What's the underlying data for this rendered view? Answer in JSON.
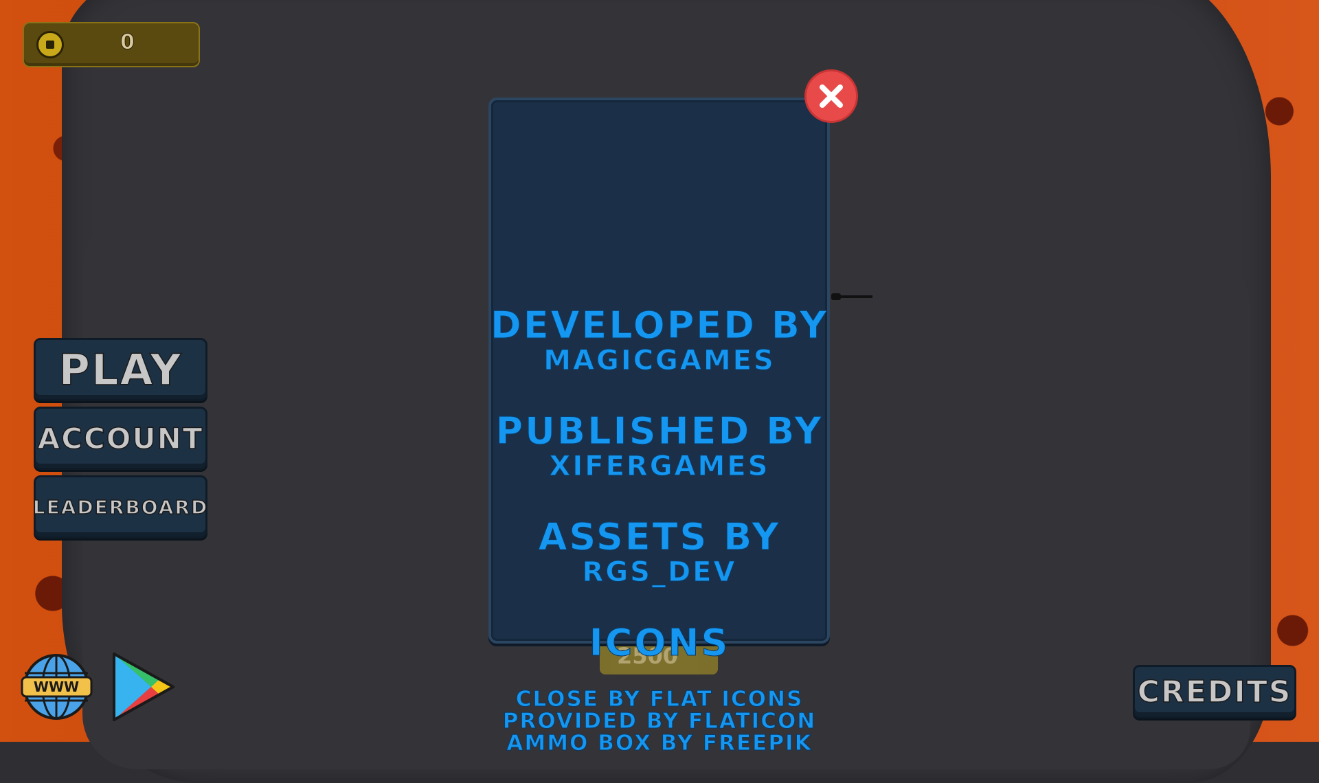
{
  "hud": {
    "coins": "0"
  },
  "menu": {
    "play_label": "PLAY",
    "account_label": "ACCOUNT",
    "leaderboard_label": "LEADERBOARD",
    "credits_label": "CREDITS"
  },
  "links": {
    "www_label": "WWW"
  },
  "shop": {
    "price": "2500"
  },
  "credits_panel": {
    "developed_heading": "DEVELOPED BY",
    "developed_name": "MAGICGAMES",
    "published_heading": "PUBLISHED BY",
    "published_name": "XIFERGAMES",
    "assets_heading": "ASSETS BY",
    "assets_name": "RGS_DEV",
    "icons_heading": "ICONS",
    "icons_line1": "CLOSE BY FLAT ICONS",
    "icons_line2": "PROVIDED BY FLATICON",
    "icons_line3": "AMMO BOX BY FREEPIK"
  },
  "colors": {
    "lava": "#c8400c",
    "arena": "#333338",
    "panel": "#1b3048",
    "credit_text": "#1596f0",
    "close_button": "#e84a4a",
    "coin_box": "#5a4a10"
  },
  "icons": [
    "coin-icon",
    "close-icon",
    "globe-icon",
    "play-store-icon"
  ]
}
